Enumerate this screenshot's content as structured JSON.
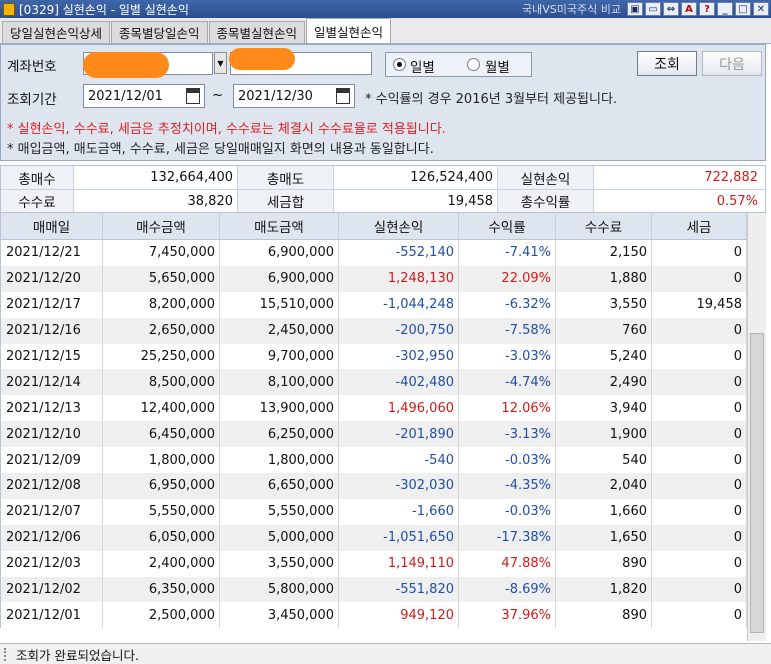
{
  "window": {
    "title": "[0329] 실현손익 - 일별 실현손익",
    "subtitle": "국내VS미국주식 비교"
  },
  "tabs": [
    {
      "label": "당일실현손익상세"
    },
    {
      "label": "종목별당일손익"
    },
    {
      "label": "종목별실현손익"
    },
    {
      "label": "일별실현손익"
    }
  ],
  "form": {
    "account_label": "계좌번호",
    "period_label": "조회기간",
    "start_date": "2021/12/01",
    "tilde": "~",
    "end_date": "2021/12/30",
    "period_note": "* 수익률의 경우 2016년 3월부터 제공됩니다.",
    "radio_daily": "일별",
    "radio_monthly": "월별",
    "query_button": "조회",
    "next_button": "다음",
    "note_red": "* 실현손익, 수수료, 세금은 추정치이며, 수수료는 체결시 수수료율로 적용됩니다.",
    "note_black": "* 매입금액, 매도금액, 수수료, 세금은 당일매매일지 화면의 내용과 동일합니다.",
    "highlight_color": "#ff8a1a"
  },
  "summary": {
    "total_buy_label": "총매수",
    "total_buy": "132,664,400",
    "total_sell_label": "총매도",
    "total_sell": "126,524,400",
    "realized_label": "실현손익",
    "realized": "722,882",
    "fee_label": "수수료",
    "fee": "38,820",
    "tax_label": "세금합",
    "tax": "19,458",
    "return_label": "총수익률",
    "return": "0.57%"
  },
  "table": {
    "headers": [
      "매매일",
      "매수금액",
      "매도금액",
      "실현손익",
      "수익률",
      "수수료",
      "세금"
    ],
    "rows": [
      [
        "2021/12/21",
        "7,450,000",
        "6,900,000",
        "-552,140",
        "-7.41%",
        "2,150",
        "0"
      ],
      [
        "2021/12/20",
        "5,650,000",
        "6,900,000",
        "1,248,130",
        "22.09%",
        "1,880",
        "0"
      ],
      [
        "2021/12/17",
        "8,200,000",
        "15,510,000",
        "-1,044,248",
        "-6.32%",
        "3,550",
        "19,458"
      ],
      [
        "2021/12/16",
        "2,650,000",
        "2,450,000",
        "-200,750",
        "-7.58%",
        "760",
        "0"
      ],
      [
        "2021/12/15",
        "25,250,000",
        "9,700,000",
        "-302,950",
        "-3.03%",
        "5,240",
        "0"
      ],
      [
        "2021/12/14",
        "8,500,000",
        "8,100,000",
        "-402,480",
        "-4.74%",
        "2,490",
        "0"
      ],
      [
        "2021/12/13",
        "12,400,000",
        "13,900,000",
        "1,496,060",
        "12.06%",
        "3,940",
        "0"
      ],
      [
        "2021/12/10",
        "6,450,000",
        "6,250,000",
        "-201,890",
        "-3.13%",
        "1,900",
        "0"
      ],
      [
        "2021/12/09",
        "1,800,000",
        "1,800,000",
        "-540",
        "-0.03%",
        "540",
        "0"
      ],
      [
        "2021/12/08",
        "6,950,000",
        "6,650,000",
        "-302,030",
        "-4.35%",
        "2,040",
        "0"
      ],
      [
        "2021/12/07",
        "5,550,000",
        "5,550,000",
        "-1,660",
        "-0.03%",
        "1,660",
        "0"
      ],
      [
        "2021/12/06",
        "6,050,000",
        "5,000,000",
        "-1,051,650",
        "-17.38%",
        "1,650",
        "0"
      ],
      [
        "2021/12/03",
        "2,400,000",
        "3,550,000",
        "1,149,110",
        "47.88%",
        "890",
        "0"
      ],
      [
        "2021/12/02",
        "6,350,000",
        "5,800,000",
        "-551,820",
        "-8.69%",
        "1,820",
        "0"
      ],
      [
        "2021/12/01",
        "2,500,000",
        "3,450,000",
        "949,120",
        "37.96%",
        "890",
        "0"
      ]
    ]
  },
  "status": {
    "text": "조회가 완료되었습니다."
  },
  "colors": {
    "positive": "#d41a1a",
    "negative": "#1f4fa8"
  }
}
